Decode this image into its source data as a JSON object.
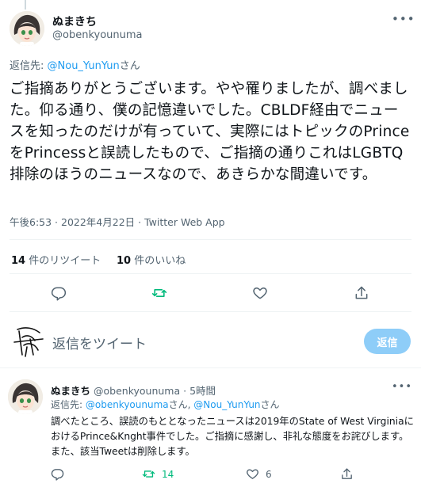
{
  "main_tweet": {
    "display_name": "ぬまきち",
    "handle": "@obenkyounuma",
    "more_label": "•••",
    "reply_to_prefix": "返信先: ",
    "reply_to_handle": "@Nou_YunYun",
    "reply_to_suffix": "さん",
    "text": "ご指摘ありがとうございます。やや罹りましたが、調べました。仰る通り、僕の記憶違いでした。CBLDF経由でニュースを知ったのだけが有っていて、実際にはトピックのPrinceをPrincessと誤読したもので、ご指摘の通りこれはLGBTQ排除のほうのニュースなので、あきらかな間違いです。",
    "timestamp": "午後6:53 · 2022年4月22日 · Twitter Web App",
    "retweets_count": "14",
    "retweets_label": "件のリツイート",
    "likes_count": "10",
    "likes_label": "件のいいね"
  },
  "actions": {
    "reply_icon": "reply-icon",
    "retweet_icon": "retweet-icon",
    "like_icon": "heart-icon",
    "share_icon": "share-icon"
  },
  "compose": {
    "placeholder": "返信をツイート",
    "reply_button": "返信"
  },
  "reply_tweet": {
    "display_name": "ぬまきち",
    "handle": "@obenkyounuma",
    "time": "· 5時間",
    "more_label": "•••",
    "reply_to_prefix": "返信先: ",
    "reply_to_handle_1": "@obenkyounuma",
    "reply_to_mid": "さん, ",
    "reply_to_handle_2": "@Nou_YunYun",
    "reply_to_suffix": "さん",
    "text": "調べたところ、誤読のもととなったニュースは2019年のState of West VirginiaにおけるPrince&Knght事件でした。ご指摘に感謝し、非礼な態度をお詫びします。また、該当Tweetは削除します。",
    "retweet_count": "14",
    "like_count": "6"
  },
  "colors": {
    "accent": "#1d9bf0",
    "retweet_green": "#00ba7c",
    "muted": "#536471",
    "reply_button_disabled": "#8ecdf8"
  }
}
